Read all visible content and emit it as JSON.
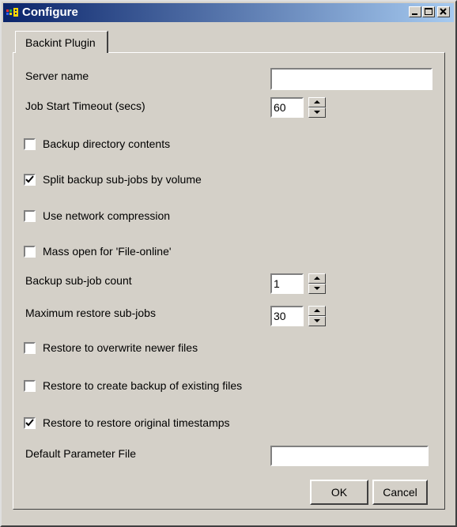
{
  "window": {
    "title": "Configure"
  },
  "tab": {
    "label": "Backint Plugin"
  },
  "fields": {
    "server_name": {
      "label": "Server name",
      "value": ""
    },
    "job_start_timeout": {
      "label": "Job Start Timeout (secs)",
      "value": "60"
    },
    "backup_subjob_count": {
      "label": "Backup sub-job count",
      "value": "1"
    },
    "max_restore_subjobs": {
      "label": "Maximum restore sub-jobs",
      "value": "30"
    },
    "default_parameter_file": {
      "label": "Default Parameter File",
      "value": ""
    }
  },
  "checkboxes": {
    "backup_directory_contents": {
      "label": "Backup directory contents",
      "checked": false
    },
    "split_backup_subjobs": {
      "label": "Split backup sub-jobs by volume",
      "checked": true
    },
    "use_network_compression": {
      "label": "Use network compression",
      "checked": false
    },
    "mass_open_file_online": {
      "label": "Mass open for 'File-online'",
      "checked": false
    },
    "restore_overwrite_newer": {
      "label": "Restore to overwrite newer files",
      "checked": false
    },
    "restore_create_backup": {
      "label": "Restore to create backup of existing files",
      "checked": false
    },
    "restore_original_timestamps": {
      "label": "Restore to restore original timestamps",
      "checked": true
    }
  },
  "buttons": {
    "ok": "OK",
    "cancel": "Cancel"
  },
  "icons": {
    "app": "app-icon",
    "minimize": "minimize-icon",
    "maximize": "maximize-icon",
    "close": "close-icon",
    "spin_up": "arrow-up-icon",
    "spin_down": "arrow-down-icon",
    "check": "checkmark-icon"
  },
  "colors": {
    "titlebar_start": "#0a246a",
    "titlebar_end": "#a6caf0",
    "face": "#d4d0c8"
  }
}
